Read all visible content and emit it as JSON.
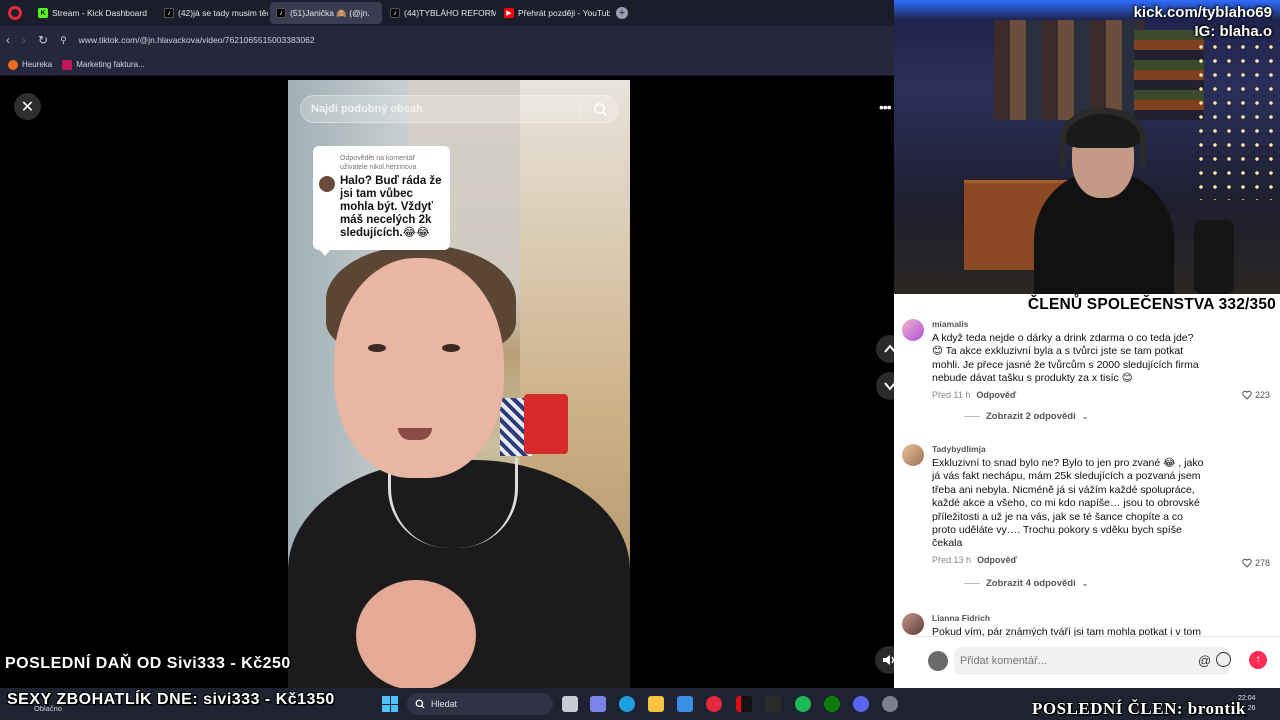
{
  "browser": {
    "tabs": [
      {
        "label": "Stream - Kick Dashboard",
        "icon": "kick-icon"
      },
      {
        "label": "(42)já se tady musim těch",
        "icon": "tiktok-icon"
      },
      {
        "label": "(51)Janička 🙈 (@jn.",
        "icon": "tiktok-icon"
      },
      {
        "label": "(44)TYBLÁHO REFORMED",
        "icon": "tiktok-icon"
      },
      {
        "label": "Přehrát později - YouTube",
        "icon": "youtube-icon"
      }
    ],
    "url": "www.tiktok.com/@jn.hlavackova/video/7621065515003383062",
    "bookmarks": [
      "Heureka",
      "Marketing faktura..."
    ]
  },
  "video": {
    "search_placeholder": "Najdi podobný obsah",
    "reply_card": {
      "header": "Odpovědět na komentář uživatele nikol.herzinova",
      "text": "Halo? Buď ráda že jsi tam vůbec mohla být. Vždyť máš necelých 2k sledujících.😂😂"
    }
  },
  "stream_overlay": {
    "kick_handle": "kick.com/tyblaho69",
    "ig_handle": "IG: blaha.o",
    "members": "ČLENŮ SPOLEČENSTVA 332/350",
    "last_tax": "POSLEDNÍ DAŇ OD Sivi333 - Kč250",
    "richest": "SEXY ZBOHATLÍK DNE: sivi333 - Kč1350",
    "last_member": "POSLEDNÍ ČLEN: brontik"
  },
  "comments": [
    {
      "user": "miamalis",
      "text": "A když teda nejde o dárky a drink zdarma o co teda jde? 😊 Ta akce exkluzivní byla a s tvůrci jste se tam potkat mohli. Je přece jasné že tvůrcům s 2000 sledujících firma nebude dávat tašku s produkty za x tisíc 😊",
      "time": "Před 11 h",
      "reply_label": "Odpověď",
      "likes": "223",
      "view_replies": "Zobrazit 2 odpovědi"
    },
    {
      "user": "Tadybydlimja",
      "text": "Exkluzivní to snad bylo ne? Bylo to jen pro zvané 😂 , jako já vás fakt nechápu, mám 25k sledujících a pozvaná jsem třeba ani nebyla. Nicméně já si vážím každé spolupráce, každé akce a všeho, co mi kdo napíše… jsou to obrovské příležitosti a už je na vás, jak se té šance chopíte a co proto uděláte vy…. Trochu pokory s vděku bych spíše čekala",
      "time": "Před 13 h",
      "reply_label": "Odpověď",
      "likes": "278",
      "view_replies": "Zobrazit 4 odpovědi"
    },
    {
      "user": "Lianna Fidrich",
      "text": "Pokud vím, pár známých tváří jsi tam mohla potkat i v tom"
    }
  ],
  "composer": {
    "placeholder": "Přidat komentář..."
  },
  "taskbar": {
    "weather": "Oblačno",
    "search": "Hledat",
    "time": "22:04",
    "date": "26"
  },
  "colors": {
    "accent": "#fe2c55",
    "kick": "#53fc18",
    "tab_bg": "#1b1d2a"
  }
}
